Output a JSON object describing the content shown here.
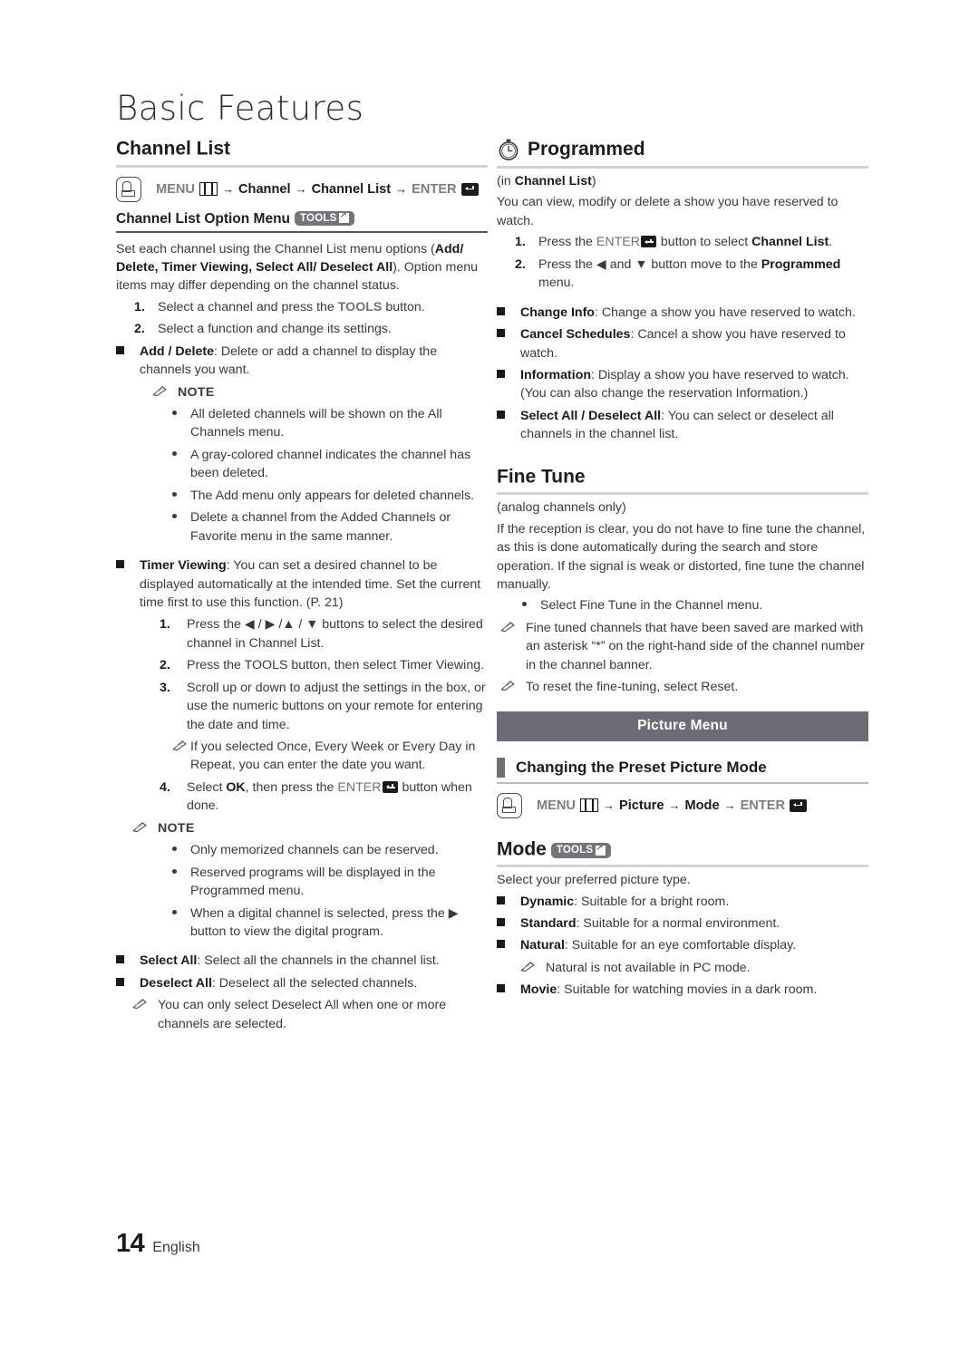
{
  "document": {
    "title": "Basic Features",
    "page_number": "14",
    "language": "English"
  },
  "icons": {
    "press": "press-hand-icon",
    "menu": "menu-bars-icon",
    "enter": "enter-key-icon",
    "tools": "TOOLS",
    "stopwatch": "stopwatch-icon",
    "pencil": "pencil-note-icon"
  },
  "colors": {
    "banner_bg": "#6b6d76",
    "badge_bg": "#72757c",
    "heading_rule": "#d2d2d2",
    "marker": "#6e6e78",
    "text": "#3a3a3a",
    "bold_text": "#1a1a1a",
    "dim_text": "#7b7e85"
  },
  "left_column": {
    "section_title": "Channel List",
    "path": {
      "menu_label": "MENU",
      "sep1": "→",
      "item1": "Channel",
      "sep2": "→",
      "item2": "Channel List",
      "sep3": "→",
      "enter_label": "ENTER"
    },
    "option_menu_heading": "Channel List Option Menu",
    "intro_p1": "Set each channel using the Channel List menu options (",
    "intro_p1_bold": "Add/ Delete, Timer Viewing, Select All/ Deselect All",
    "intro_p1_tail": "). Option menu items may differ depending on the channel status.",
    "steps": [
      {
        "num": "1.",
        "text_pre": "Select a channel and press the ",
        "text_mid": "TOOLS",
        "text_post": " button."
      },
      {
        "num": "2.",
        "text_pre": "Select a function and change its settings.",
        "text_mid": "",
        "text_post": ""
      }
    ],
    "add_delete": {
      "label": "Add / Delete",
      "text": ": Delete or add a channel to display the channels you want."
    },
    "note1_label": "NOTE",
    "note1_bullets": [
      "All deleted channels will be shown on the All Channels menu.",
      "A gray-colored channel indicates the channel has been deleted.",
      "The Add menu only appears for deleted channels.",
      "Delete a channel from the Added Channels or Favorite menu in the same manner."
    ],
    "timer_viewing": {
      "label": "Timer Viewing",
      "text": ": You can set a desired channel to be displayed automatically at the intended time. Set the current time first to use this function. (P. 21)"
    },
    "timer_steps": [
      {
        "num": "1.",
        "text": "Press the ◀ / ▶ /▲ / ▼ buttons to select the desired channel in Channel List."
      },
      {
        "num": "2.",
        "text": "Press the TOOLS button, then select Timer Viewing."
      },
      {
        "num": "3.",
        "text": "Scroll up or down to adjust the settings in the box, or use the numeric buttons on your remote for entering the date and time."
      }
    ],
    "repeat_note": "If you selected Once, Every Week or Every Day in Repeat, you can enter the date you want.",
    "step4": {
      "num": "4.",
      "text_pre": "Select ",
      "bold": "OK",
      "text_mid": ", then press the ",
      "enter": "ENTER",
      "text_post": " button when done."
    },
    "note2_label": "NOTE",
    "note2_bullets": [
      "Only memorized channels can be reserved.",
      "Reserved programs will be displayed in the Programmed menu.",
      "When a digital channel is selected, press the ▶ button to view the digital program."
    ],
    "select_all": {
      "label": "Select All",
      "text": ": Select all the channels in the channel list."
    },
    "deselect_all": {
      "label": "Deselect All",
      "text": ": Deselect all the selected channels."
    },
    "deselect_note": "You can only select Deselect All when one or more channels are selected."
  },
  "right_column": {
    "programmed": {
      "title": "Programmed",
      "subtitle_pre": "(in ",
      "subtitle_bold": "Channel List",
      "subtitle_post": ")",
      "intro": "You can view, modify or delete a show you have reserved to watch.",
      "steps": [
        {
          "num": "1.",
          "pre": "Press the ",
          "enter": "ENTER",
          "post": " button to select ",
          "bold": "Channel List",
          "tail": "."
        },
        {
          "num": "2.",
          "pre": "Press the ◀ and ▼ button move to the ",
          "bold": "Programmed",
          "post": " menu."
        }
      ],
      "items": [
        {
          "label": "Change Info",
          "text": ": Change a show you have reserved to watch."
        },
        {
          "label": "Cancel Schedules",
          "text": ": Cancel a show you have reserved to watch."
        },
        {
          "label": "Information",
          "text": ": Display a show you have reserved to watch. (You can also change the reservation Information.)"
        },
        {
          "label": "Select All / Deselect All",
          "text": ": You can select or deselect all channels in the channel list."
        }
      ]
    },
    "fine_tune": {
      "title": "Fine Tune",
      "subtitle": "(analog channels only)",
      "body": "If the reception is clear, you do not have to fine tune the channel, as this is done automatically during the search and store operation. If the signal is weak or distorted, fine tune the channel manually.",
      "bullet": "Select Fine Tune in the Channel menu.",
      "note1": "Fine tuned channels that have been saved are marked with an asterisk “*” on the right-hand side of the channel number in the channel banner.",
      "note2": "To reset the fine-tuning, select Reset."
    },
    "picture_menu_banner": "Picture Menu",
    "preset_mode": {
      "heading": "Changing the Preset Picture Mode",
      "path": {
        "menu_label": "MENU",
        "sep1": "→",
        "item1": "Picture",
        "sep2": "→",
        "item2": "Mode",
        "sep3": "→",
        "enter_label": "ENTER"
      }
    },
    "mode": {
      "title": "Mode",
      "intro": "Select your preferred picture type.",
      "items": [
        {
          "label": "Dynamic",
          "text": ": Suitable for a bright room."
        },
        {
          "label": "Standard",
          "text": ": Suitable for a normal environment."
        },
        {
          "label": "Natural",
          "text": ": Suitable for an eye comfortable display."
        },
        {
          "label": "Movie",
          "text": ": Suitable for watching movies in a dark room."
        }
      ],
      "natural_note": "Natural is not available in PC mode."
    }
  }
}
